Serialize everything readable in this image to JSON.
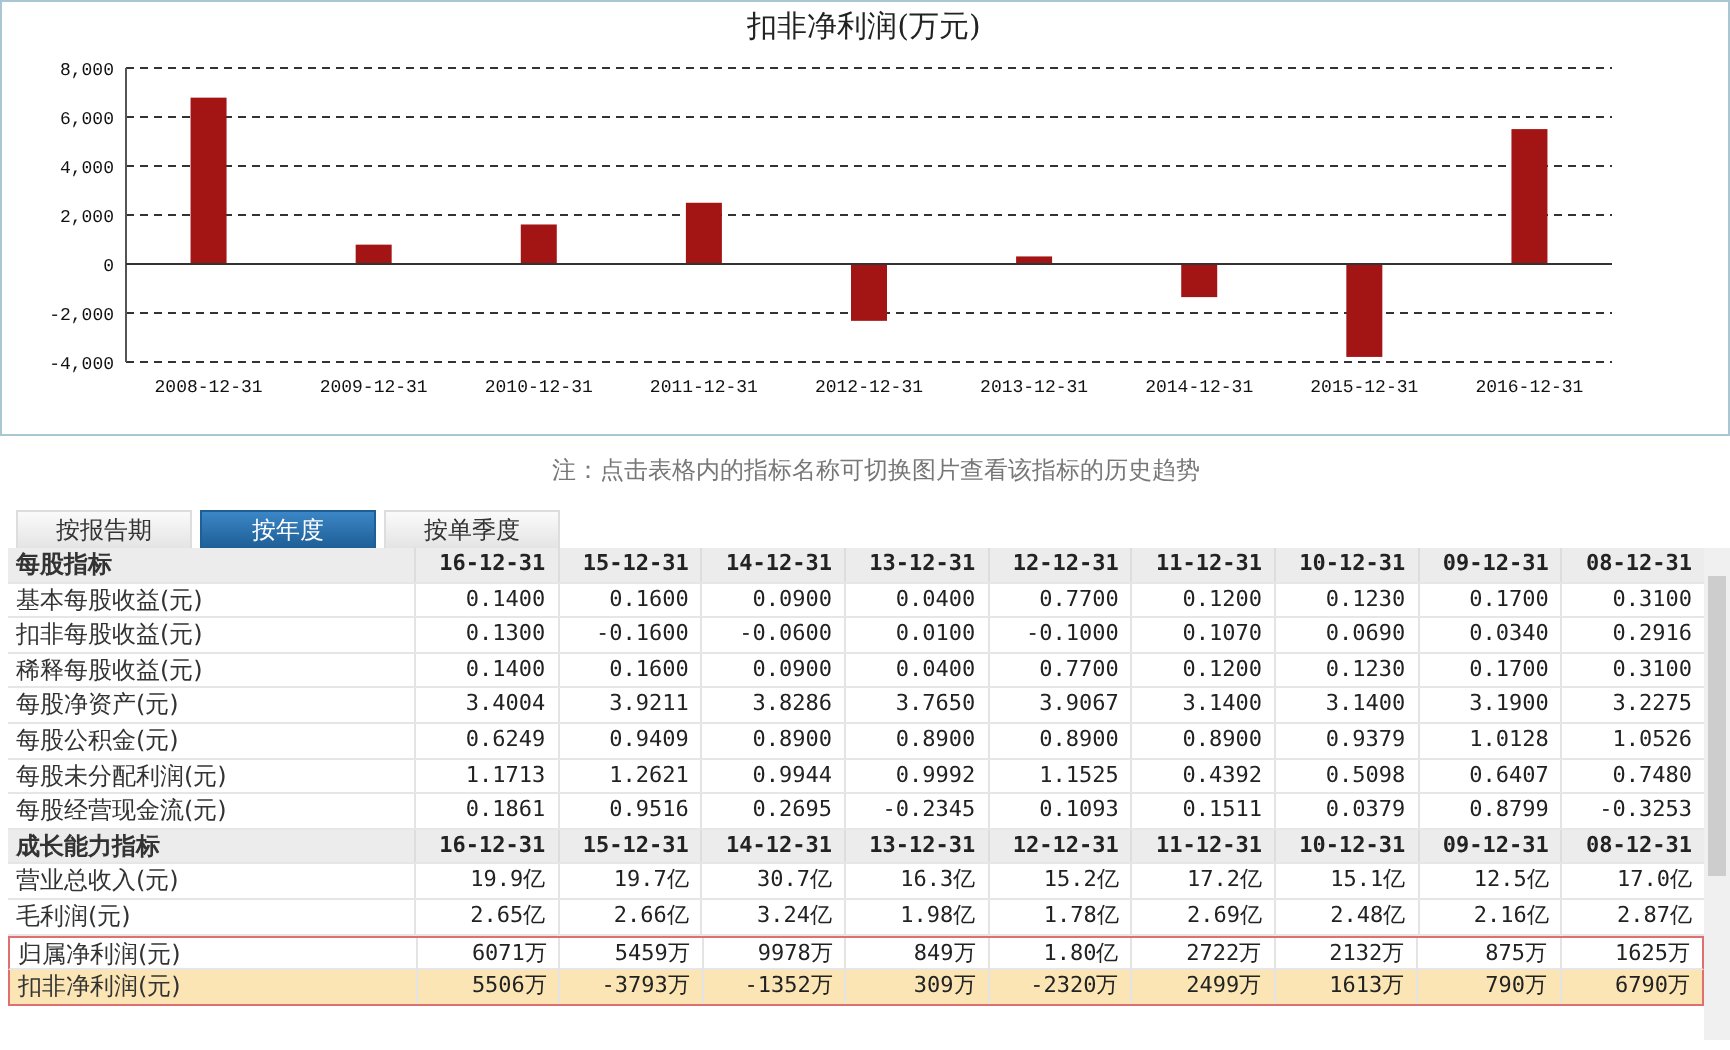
{
  "chart_data": {
    "type": "bar",
    "title": "扣非净利润(万元)",
    "categories": [
      "2008-12-31",
      "2009-12-31",
      "2010-12-31",
      "2011-12-31",
      "2012-12-31",
      "2013-12-31",
      "2014-12-31",
      "2015-12-31",
      "2016-12-31"
    ],
    "grid": true,
    "series": [
      {
        "color": "#a31515",
        "values": [
          6790,
          790,
          1613,
          2499,
          -2320,
          309,
          -1352,
          -3793,
          5506
        ]
      }
    ],
    "ylim": [
      -4000,
      8000
    ],
    "yticks": [
      {
        "value": -4000,
        "label": "-4,000"
      },
      {
        "value": -2000,
        "label": "-2,000"
      },
      {
        "value": 0,
        "label": "0"
      },
      {
        "value": 2000,
        "label": "2,000"
      },
      {
        "value": 4000,
        "label": "4,000"
      },
      {
        "value": 6000,
        "label": "6,000"
      },
      {
        "value": 8000,
        "label": "8,000"
      }
    ]
  },
  "note": "注：点击表格内的指标名称可切换图片查看该指标的历史趋势",
  "tabs": [
    {
      "label": "按报告期",
      "selected": false
    },
    {
      "label": "按年度",
      "selected": true
    },
    {
      "label": "按单季度",
      "selected": false
    }
  ],
  "table": {
    "sections": [
      {
        "title": "每股指标",
        "columns": [
          "16-12-31",
          "15-12-31",
          "14-12-31",
          "13-12-31",
          "12-12-31",
          "11-12-31",
          "10-12-31",
          "09-12-31",
          "08-12-31"
        ],
        "rows": [
          {
            "label": "基本每股收益(元)",
            "values": [
              "0.1400",
              "0.1600",
              "0.0900",
              "0.0400",
              "0.7700",
              "0.1200",
              "0.1230",
              "0.1700",
              "0.3100"
            ],
            "outlined": false,
            "highlighted": false
          },
          {
            "label": "扣非每股收益(元)",
            "values": [
              "0.1300",
              "-0.1600",
              "-0.0600",
              "0.0100",
              "-0.1000",
              "0.1070",
              "0.0690",
              "0.0340",
              "0.2916"
            ],
            "outlined": false,
            "highlighted": false
          },
          {
            "label": "稀释每股收益(元)",
            "values": [
              "0.1400",
              "0.1600",
              "0.0900",
              "0.0400",
              "0.7700",
              "0.1200",
              "0.1230",
              "0.1700",
              "0.3100"
            ],
            "outlined": false,
            "highlighted": false
          },
          {
            "label": "每股净资产(元)",
            "values": [
              "3.4004",
              "3.9211",
              "3.8286",
              "3.7650",
              "3.9067",
              "3.1400",
              "3.1400",
              "3.1900",
              "3.2275"
            ],
            "outlined": false,
            "highlighted": false
          },
          {
            "label": "每股公积金(元)",
            "values": [
              "0.6249",
              "0.9409",
              "0.8900",
              "0.8900",
              "0.8900",
              "0.8900",
              "0.9379",
              "1.0128",
              "1.0526"
            ],
            "outlined": false,
            "highlighted": false
          },
          {
            "label": "每股未分配利润(元)",
            "values": [
              "1.1713",
              "1.2621",
              "0.9944",
              "0.9992",
              "1.1525",
              "0.4392",
              "0.5098",
              "0.6407",
              "0.7480"
            ],
            "outlined": false,
            "highlighted": false
          },
          {
            "label": "每股经营现金流(元)",
            "values": [
              "0.1861",
              "0.9516",
              "0.2695",
              "-0.2345",
              "0.1093",
              "0.1511",
              "0.0379",
              "0.8799",
              "-0.3253"
            ],
            "outlined": false,
            "highlighted": false
          }
        ]
      },
      {
        "title": "成长能力指标",
        "columns": [
          "16-12-31",
          "15-12-31",
          "14-12-31",
          "13-12-31",
          "12-12-31",
          "11-12-31",
          "10-12-31",
          "09-12-31",
          "08-12-31"
        ],
        "rows": [
          {
            "label": "营业总收入(元)",
            "values": [
              "19.9亿",
              "19.7亿",
              "30.7亿",
              "16.3亿",
              "15.2亿",
              "17.2亿",
              "15.1亿",
              "12.5亿",
              "17.0亿"
            ],
            "outlined": false,
            "highlighted": false
          },
          {
            "label": "毛利润(元)",
            "values": [
              "2.65亿",
              "2.66亿",
              "3.24亿",
              "1.98亿",
              "1.78亿",
              "2.69亿",
              "2.48亿",
              "2.16亿",
              "2.87亿"
            ],
            "outlined": false,
            "highlighted": false
          },
          {
            "label": "归属净利润(元)",
            "values": [
              "6071万",
              "5459万",
              "9978万",
              "849万",
              "1.80亿",
              "2722万",
              "2132万",
              "875万",
              "1625万"
            ],
            "outlined": true,
            "highlighted": false
          },
          {
            "label": "扣非净利润(元)",
            "values": [
              "5506万",
              "-3793万",
              "-1352万",
              "309万",
              "-2320万",
              "2499万",
              "1613万",
              "790万",
              "6790万"
            ],
            "outlined": true,
            "highlighted": true
          }
        ]
      }
    ]
  }
}
